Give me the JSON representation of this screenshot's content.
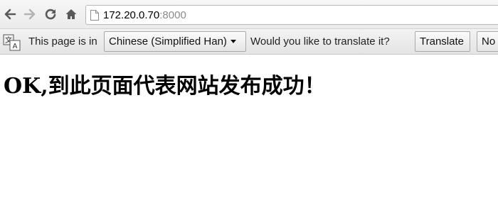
{
  "toolbar": {
    "back_icon": "back-arrow-icon",
    "forward_icon": "forward-arrow-icon",
    "reload_icon": "reload-icon",
    "home_icon": "home-icon",
    "url_host": "172.20.0.70",
    "url_port": ":8000"
  },
  "infobar": {
    "icon": "translate-icon",
    "prefix": "This page is in",
    "language": "Chinese (Simplified Han)",
    "question": "Would you like to translate it?",
    "translate_label": "Translate",
    "no_label": "No"
  },
  "page": {
    "heading": "OK,到此页面代表网站发布成功！"
  }
}
